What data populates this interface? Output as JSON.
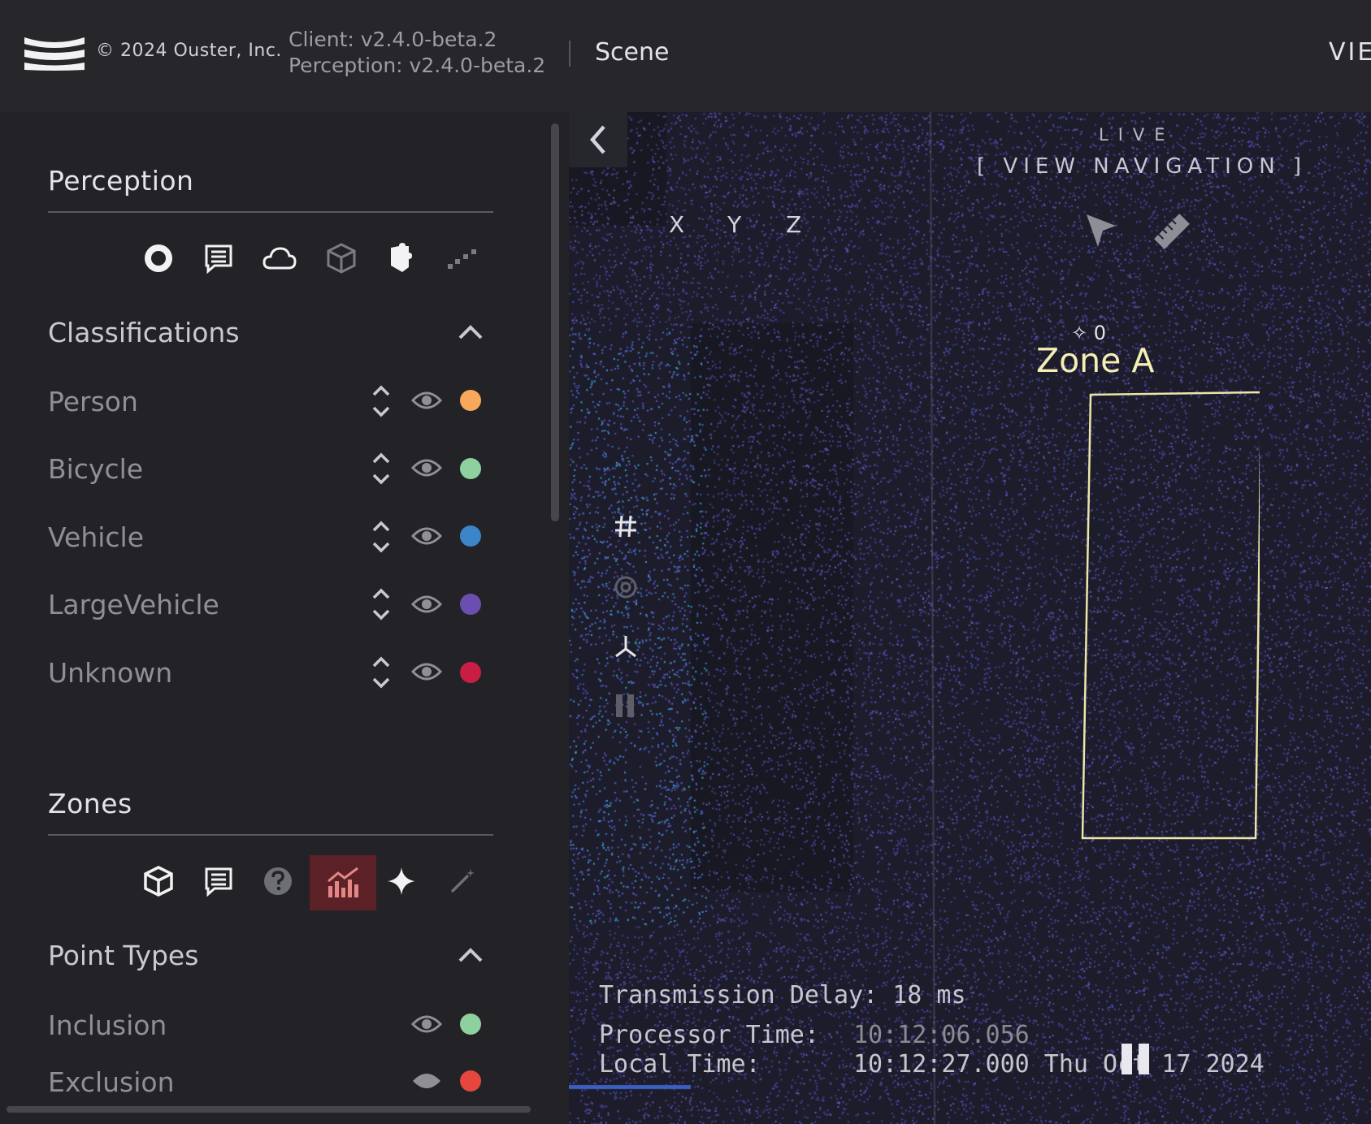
{
  "header": {
    "copyright": "© 2024 Ouster, Inc.",
    "client_version": "Client: v2.4.0-beta.2",
    "perception_version": "Perception: v2.4.0-beta.2",
    "page": "Scene",
    "right_label": "VIE"
  },
  "perception": {
    "title": "Perception",
    "icons": [
      "record-icon",
      "list-icon",
      "cloud-icon",
      "cube-icon",
      "puzzle-icon",
      "trail-icon"
    ],
    "classifications": {
      "title": "Classifications",
      "items": [
        {
          "label": "Person",
          "color": "#f7a85a"
        },
        {
          "label": "Bicycle",
          "color": "#8fd19e"
        },
        {
          "label": "Vehicle",
          "color": "#3c85c8"
        },
        {
          "label": "LargeVehicle",
          "color": "#6a4fb0"
        },
        {
          "label": "Unknown",
          "color": "#c81d45"
        }
      ]
    }
  },
  "zones": {
    "title": "Zones",
    "icons": [
      "cube-icon",
      "list-icon",
      "help-icon",
      "chart-icon",
      "sparkle-icon",
      "magic-wand-icon"
    ],
    "active_icon": "chart-icon",
    "point_types": {
      "title": "Point Types",
      "items": [
        {
          "label": "Inclusion",
          "color": "#8fd19e"
        },
        {
          "label": "Exclusion",
          "color": "#e5473f"
        }
      ]
    }
  },
  "viewport": {
    "mode": "LIVE",
    "view_navigation": "[ VIEW NAVIGATION ]",
    "axes": [
      "X",
      "Y",
      "Z"
    ],
    "zone": {
      "name": "Zone A",
      "count": "0"
    },
    "stats": {
      "transmission_delay": "Transmission Delay: 18 ms",
      "processor_time_label": "Processor Time:",
      "processor_time_value": "10:12:06.056",
      "local_time_label": "Local Time:",
      "local_time_value": "10:12:27.000 Thu Oct 17 2024"
    }
  }
}
